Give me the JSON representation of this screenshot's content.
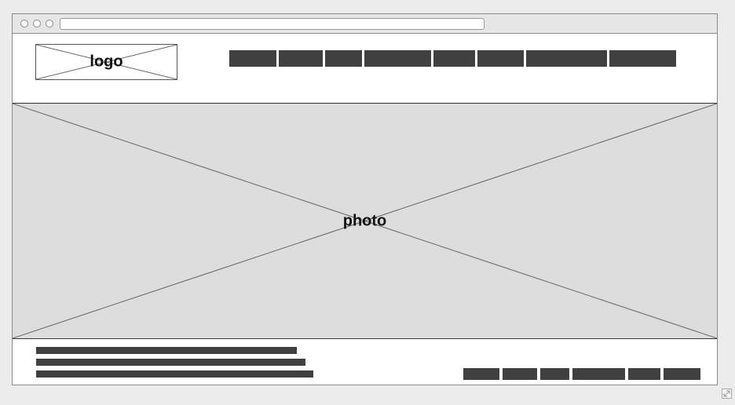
{
  "window": {
    "controls": [
      "close",
      "minimize",
      "maximize"
    ],
    "address_bar": {
      "value": ""
    }
  },
  "header": {
    "logo": {
      "label": "logo"
    },
    "nav_items": [
      "",
      "",
      "",
      "",
      "",
      "",
      "",
      ""
    ]
  },
  "hero": {
    "label": "photo"
  },
  "footer": {
    "text_lines": [
      "",
      "",
      ""
    ],
    "links": [
      "",
      "",
      "",
      "",
      "",
      ""
    ]
  },
  "colors": {
    "block_fill": "#404040",
    "photo_fill": "#dddddd",
    "page_background": "#ececec"
  }
}
